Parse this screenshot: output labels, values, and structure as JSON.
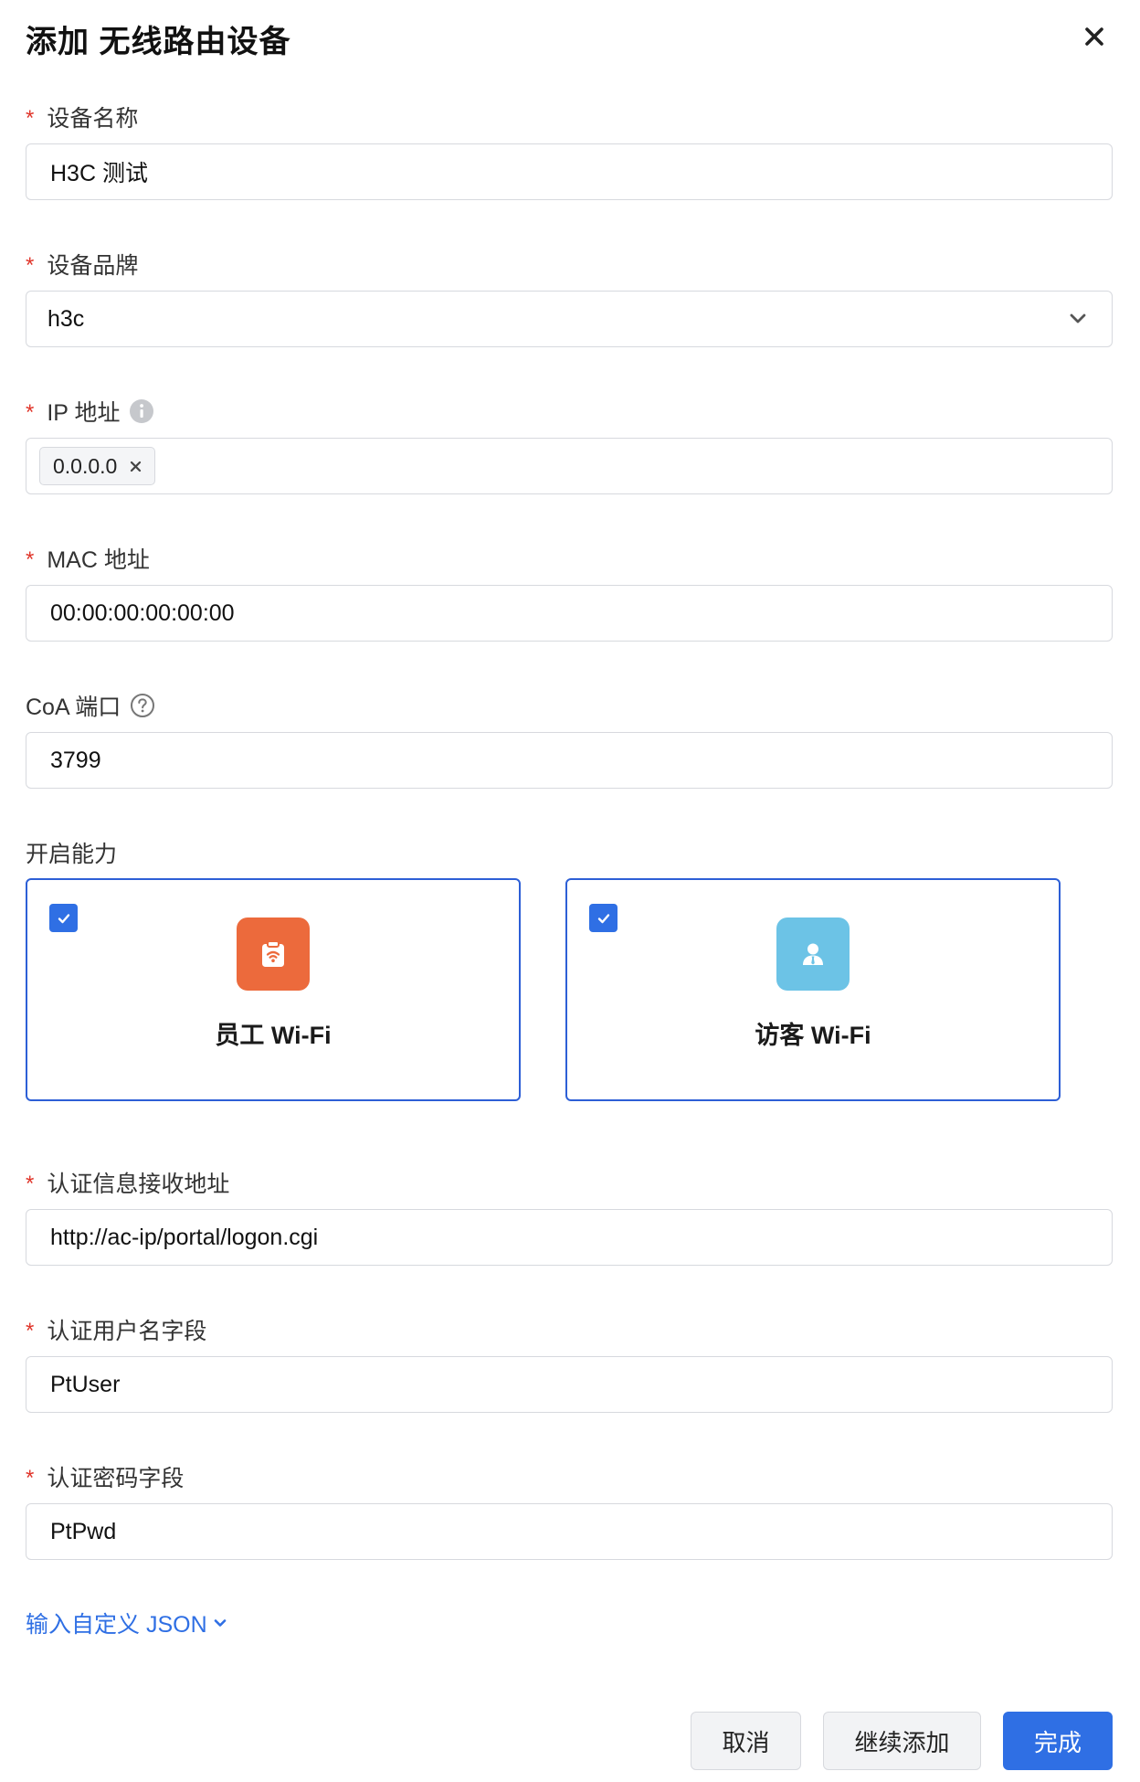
{
  "dialog": {
    "title": "添加 无线路由设备"
  },
  "form": {
    "required_mark": "*",
    "device_name": {
      "label": "设备名称",
      "value": "H3C 测试"
    },
    "brand": {
      "label": "设备品牌",
      "value": "h3c"
    },
    "ip": {
      "label": "IP 地址",
      "tags": [
        "0.0.0.0"
      ]
    },
    "mac": {
      "label": "MAC 地址",
      "value": "00:00:00:00:00:00"
    },
    "coa_port": {
      "label": "CoA 端口",
      "value": "3799"
    },
    "capabilities": {
      "label": "开启能力",
      "items": [
        {
          "label": "员工 Wi-Fi",
          "checked": true,
          "icon": "clipboard-wifi-icon",
          "color": "#ec6a3c"
        },
        {
          "label": "访客 Wi-Fi",
          "checked": true,
          "icon": "person-badge-icon",
          "color": "#6cc3e6"
        }
      ]
    },
    "auth_url": {
      "label": "认证信息接收地址",
      "value": "http://ac-ip/portal/logon.cgi"
    },
    "auth_user_field": {
      "label": "认证用户名字段",
      "value": "PtUser"
    },
    "auth_pwd_field": {
      "label": "认证密码字段",
      "value": "PtPwd"
    },
    "custom_json_link": "输入自定义 JSON"
  },
  "footer": {
    "cancel": "取消",
    "continue_add": "继续添加",
    "done": "完成"
  },
  "colors": {
    "accent": "#2f6fe4",
    "required": "#e0362b",
    "border": "#d7d9de"
  }
}
